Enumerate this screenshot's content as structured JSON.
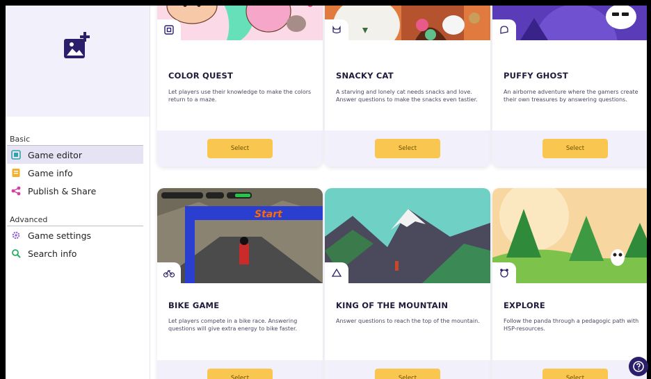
{
  "sidebar": {
    "sections": [
      {
        "title": "Basic",
        "items": [
          {
            "label": "Game editor",
            "icon": "book-icon",
            "color": "#2fa3a8",
            "active": true
          },
          {
            "label": "Game info",
            "icon": "document-icon",
            "color": "#f2b230"
          },
          {
            "label": "Publish & Share",
            "icon": "share-icon",
            "color": "#d63ea8"
          }
        ]
      },
      {
        "title": "Advanced",
        "items": [
          {
            "label": "Game settings",
            "icon": "gear-icon",
            "color": "#8f5fd0"
          },
          {
            "label": "Search info",
            "icon": "search-icon",
            "color": "#27ae60"
          }
        ]
      }
    ]
  },
  "games": [
    {
      "title": "COLOR QUEST",
      "description": "Let players use their knowledge to make the colors return to a maze.",
      "icon": "target-icon",
      "button": "Select"
    },
    {
      "title": "SNACKY CAT",
      "description": "A starving and lonely cat needs snacks and love. Answer questions to make the snacks even tastier.",
      "icon": "cat-icon",
      "button": "Select"
    },
    {
      "title": "PUFFY GHOST",
      "description": "An airborne adventure where the gamers create their own treasures by answering questions.",
      "icon": "ghost-icon",
      "button": "Select"
    },
    {
      "title": "BIKE GAME",
      "description": "Let players compete in a bike race. Answering questions will give extra energy to bike faster.",
      "icon": "bike-icon",
      "button": "Select",
      "image_text": "Start"
    },
    {
      "title": "KING OF THE MOUNTAIN",
      "description": "Answer questions to reach the top of the mountain.",
      "icon": "mountain-icon",
      "button": "Select"
    },
    {
      "title": "EXPLORE",
      "description": "Follow the panda through a pedagogic path with HSP-resources.",
      "icon": "panda-icon",
      "button": "Select"
    }
  ],
  "colors": {
    "accent": "#f9c74f",
    "sidebar_bg": "#f2f0fb",
    "dark_purple": "#2b1f6b"
  },
  "help": {
    "icon": "question-icon"
  }
}
